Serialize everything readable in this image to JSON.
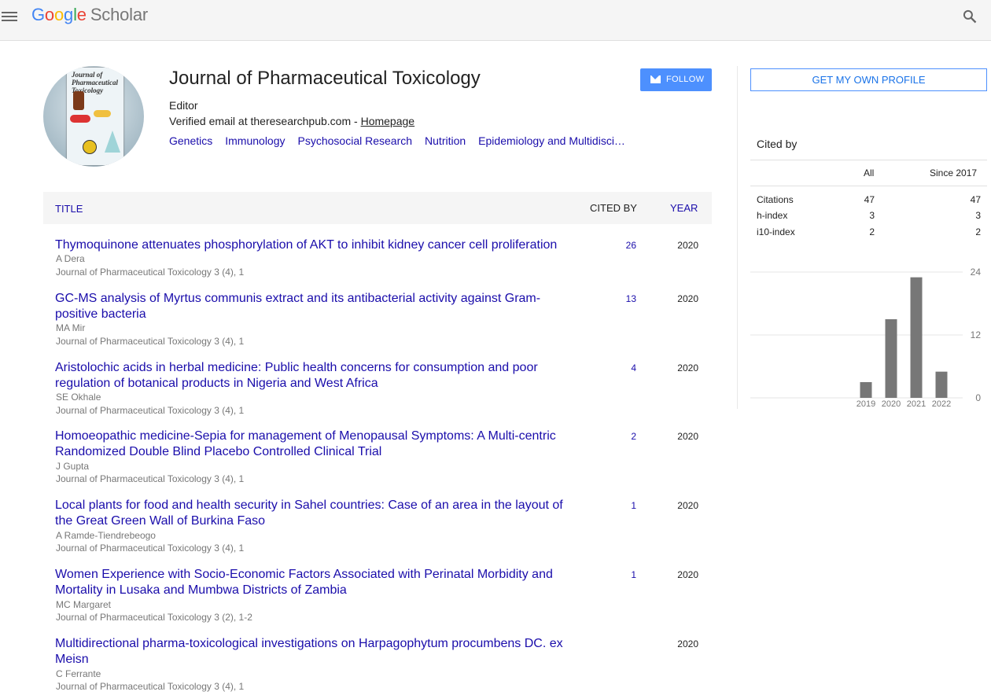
{
  "header": {
    "logo_letters": [
      "G",
      "o",
      "o",
      "g",
      "l",
      "e"
    ],
    "logo_suffix": "Scholar"
  },
  "profile": {
    "cover_title": "Journal of Pharmaceutical Toxicology",
    "name": "Journal of Pharmaceutical Toxicology",
    "affiliation": "Editor",
    "verified_email": "Verified email at theresearchpub.com - ",
    "homepage_label": "Homepage",
    "interests": [
      "Genetics",
      "Immunology",
      "Psychosocial Research",
      "Nutrition",
      "Epidemiology and Multidisci…"
    ],
    "follow_label": "FOLLOW"
  },
  "table": {
    "headers": {
      "title": "TITLE",
      "cited_by": "CITED BY",
      "year": "YEAR"
    },
    "articles": [
      {
        "title": "Thymoquinone attenuates phosphorylation of AKT to inhibit kidney cancer cell proliferation",
        "authors": "A Dera",
        "venue": "Journal of Pharmaceutical Toxicology 3 (4), 1",
        "cited_by": "26",
        "year": "2020"
      },
      {
        "title": "GC-MS analysis of Myrtus communis extract and its antibacterial activity against Gram-positive bacteria",
        "authors": "MA Mir",
        "venue": "Journal of Pharmaceutical Toxicology 3 (4), 1",
        "cited_by": "13",
        "year": "2020"
      },
      {
        "title": "Aristolochic acids in herbal medicine: Public health concerns for consumption and poor regulation of botanical products in Nigeria and West Africa",
        "authors": "SE Okhale",
        "venue": "Journal of Pharmaceutical Toxicology 3 (4), 1",
        "cited_by": "4",
        "year": "2020"
      },
      {
        "title": "Homoeopathic medicine-Sepia for management of Menopausal Symptoms: A Multi-centric Randomized Double Blind Placebo Controlled Clinical Trial",
        "authors": "J Gupta",
        "venue": "Journal of Pharmaceutical Toxicology 3 (4), 1",
        "cited_by": "2",
        "year": "2020"
      },
      {
        "title": "Local plants for food and health security in Sahel countries: Case of an area in the layout of the Great Green Wall of Burkina Faso",
        "authors": "A Ramde-Tiendrebeogo",
        "venue": "Journal of Pharmaceutical Toxicology 3 (4), 1",
        "cited_by": "1",
        "year": "2020"
      },
      {
        "title": "Women Experience with Socio-Economic Factors Associated with Perinatal Morbidity and Mortality in Lusaka and Mumbwa Districts of Zambia",
        "authors": "MC Margaret",
        "venue": "Journal of Pharmaceutical Toxicology 3 (2), 1-2",
        "cited_by": "1",
        "year": "2020"
      },
      {
        "title": "Multidirectional pharma-toxicological investigations on Harpagophytum procumbens DC. ex Meisn",
        "authors": "C Ferrante",
        "venue": "Journal of Pharmaceutical Toxicology 3 (4), 1",
        "cited_by": "",
        "year": "2020"
      }
    ]
  },
  "sidebar": {
    "own_profile_label": "GET MY OWN PROFILE",
    "cited_by_heading": "Cited by",
    "col_all": "All",
    "col_since": "Since 2017",
    "metrics": [
      {
        "label": "Citations",
        "all": "47",
        "since": "47"
      },
      {
        "label": "h-index",
        "all": "3",
        "since": "3"
      },
      {
        "label": "i10-index",
        "all": "2",
        "since": "2"
      }
    ]
  },
  "chart_data": {
    "type": "bar",
    "categories": [
      "2019",
      "2020",
      "2021",
      "2022"
    ],
    "values": [
      3,
      15,
      23,
      5
    ],
    "ylim": [
      0,
      24
    ],
    "yticks": [
      0,
      12,
      24
    ],
    "color": "#777777"
  }
}
